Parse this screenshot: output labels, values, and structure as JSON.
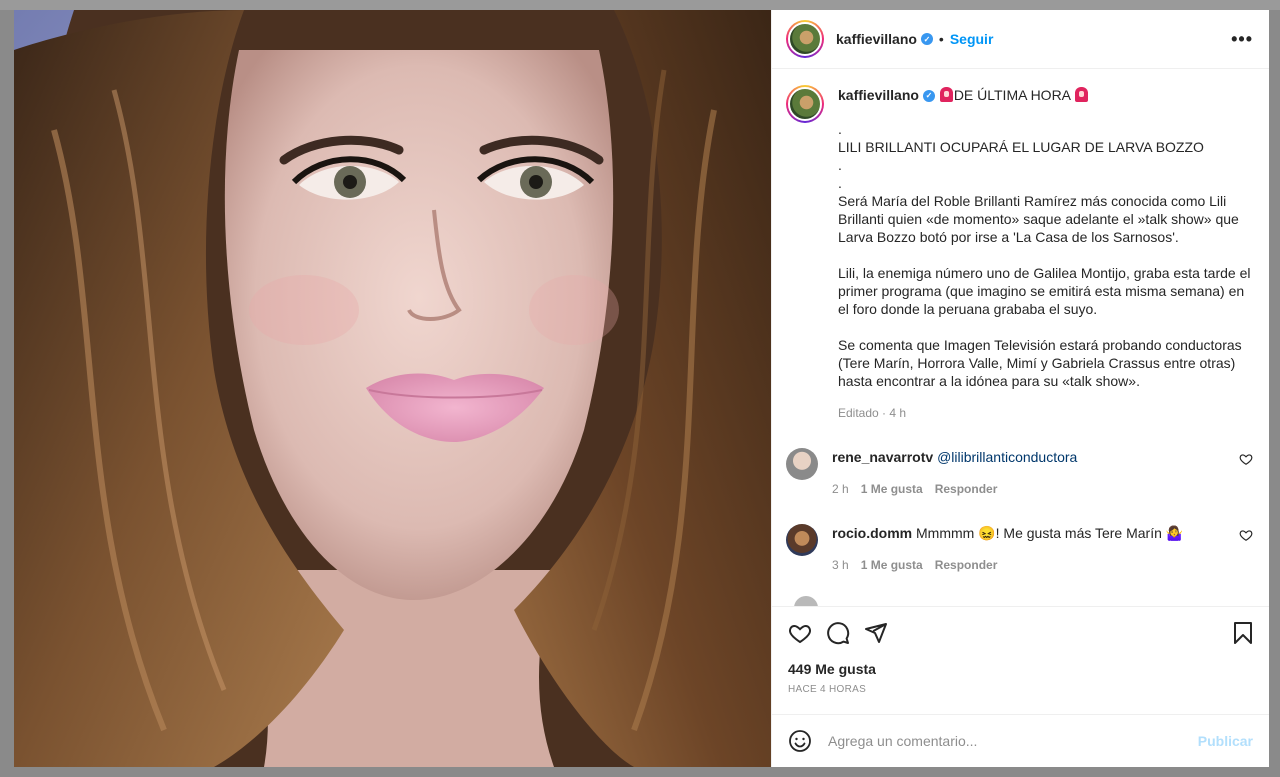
{
  "post": {
    "author": "kaffievillano",
    "verified": true,
    "follow_label": "Seguir",
    "separator": "•",
    "more_label": "•••"
  },
  "caption": {
    "author": "kaffievillano",
    "headline": "DE ÚLTIMA HORA",
    "paragraphs": [
      ".\nLILI BRILLANTI OCUPARÁ EL LUGAR DE LARVA BOZZO\n.\n.",
      "Será María del Roble Brillanti Ramírez más conocida como Lili Brillanti quien «de momento» saque adelante el »talk show» que Larva Bozzo botó por irse a 'La Casa de los Sarnosos'.",
      "Lili, la enemiga número uno de Galilea Montijo, graba esta tarde el primer programa (que imagino se emitirá esta misma semana) en el foro donde la peruana grababa el suyo.",
      "Se comenta que Imagen Televisión estará probando conductoras (Tere Marín, Horrora Valle, Mimí y Gabriela Crassus entre otras) hasta encontrar a la idónea para su «talk show»."
    ],
    "edited": "Editado · 4 h"
  },
  "comments": [
    {
      "author": "rene_navarrotv",
      "text": "@lilibrillanticonductora",
      "time": "2 h",
      "likes": "1 Me gusta",
      "reply": "Responder"
    },
    {
      "author": "rocio.domm",
      "text": "Mmmmm 😖! Me gusta más Tere Marín 🤷‍♀️",
      "time": "3 h",
      "likes": "1 Me gusta",
      "reply": "Responder"
    }
  ],
  "stats": {
    "likes": "449 Me gusta",
    "posted": "HACE 4 HORAS"
  },
  "composer": {
    "placeholder": "Agrega un comentario...",
    "publish_label": "Publicar"
  },
  "icons": {
    "like": "heart-icon",
    "comment": "comment-icon",
    "share": "paper-plane-icon",
    "save": "bookmark-icon",
    "emoji": "smiley-icon"
  },
  "colors": {
    "link_blue": "#0095f6",
    "publish_disabled": "#b2dffc",
    "verified_badge": "#3897f0",
    "muted": "#8e8e8e"
  }
}
